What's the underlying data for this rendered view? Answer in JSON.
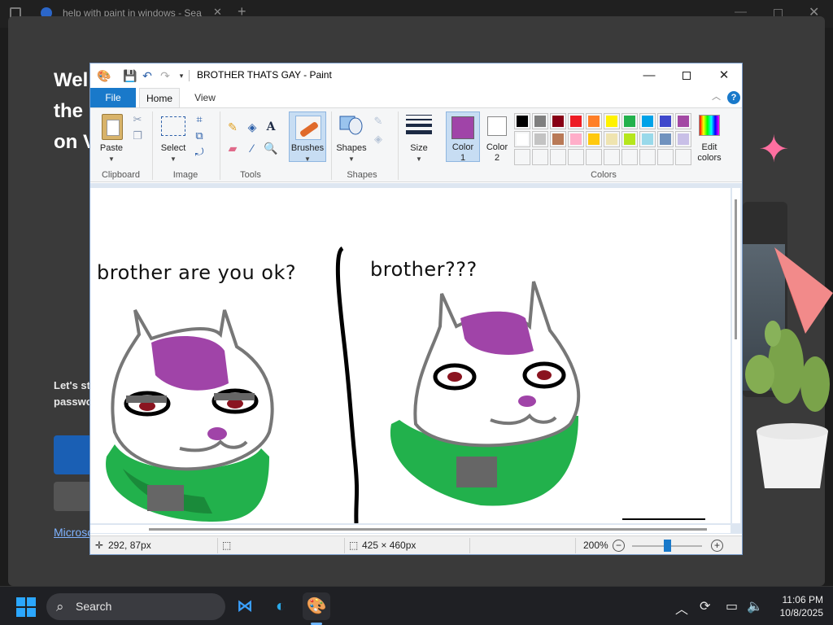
{
  "browser": {
    "tab_title": "help with paint in windows - Sea",
    "tab_close": "✕",
    "new_tab": "+",
    "minimize": "—",
    "close": "✕"
  },
  "background_page": {
    "heading_lines": [
      "Wel",
      "the",
      "on V"
    ],
    "body_lines": [
      "Let's st",
      "passwo"
    ],
    "link_text": "Microso"
  },
  "paint": {
    "title": "BROTHER THATS GAY - Paint",
    "window_controls": {
      "minimize": "—",
      "close": "✕"
    },
    "tabs": {
      "file": "File",
      "home": "Home",
      "view": "View"
    },
    "help": "?",
    "ribbon": {
      "groups": {
        "clipboard": "Clipboard",
        "image": "Image",
        "tools": "Tools",
        "shapes": "Shapes",
        "colors": "Colors"
      },
      "buttons": {
        "paste": "Paste",
        "select": "Select",
        "brushes": "Brushes",
        "shapes": "Shapes",
        "size": "Size",
        "color1": "Color\n1",
        "color2": "Color\n2",
        "edit_colors": "Edit\ncolors"
      },
      "color1_value": "#a044a8",
      "color2_value": "#ffffff",
      "palette_row1": [
        "#000000",
        "#7f7f7f",
        "#880015",
        "#ed1c24",
        "#ff7f27",
        "#fff200",
        "#22b14c",
        "#00a2e8",
        "#3f48cc",
        "#a349a4"
      ],
      "palette_row2": [
        "#ffffff",
        "#c3c3c3",
        "#b97a57",
        "#ffaec9",
        "#ffc90e",
        "#efe4b0",
        "#b5e61d",
        "#99d9ea",
        "#7092be",
        "#c8bfe7"
      ],
      "palette_row3_count": 10
    },
    "canvas": {
      "left_caption": "brother are you ok?",
      "right_caption": "brother???"
    },
    "status": {
      "cursor_pos": "292, 87px",
      "image_size": "425 × 460px",
      "zoom": "200%",
      "zoom_minus": "−",
      "zoom_plus": "+",
      "zoom_level_fraction": 0.5
    }
  },
  "taskbar": {
    "search_label": "Search",
    "time": "11:06 PM",
    "date": "10/8/2025"
  },
  "colors": {
    "file_tab": "#1979ca",
    "purple": "#a044a8",
    "green": "#22b14c",
    "dark_green": "#1a8a3a"
  }
}
